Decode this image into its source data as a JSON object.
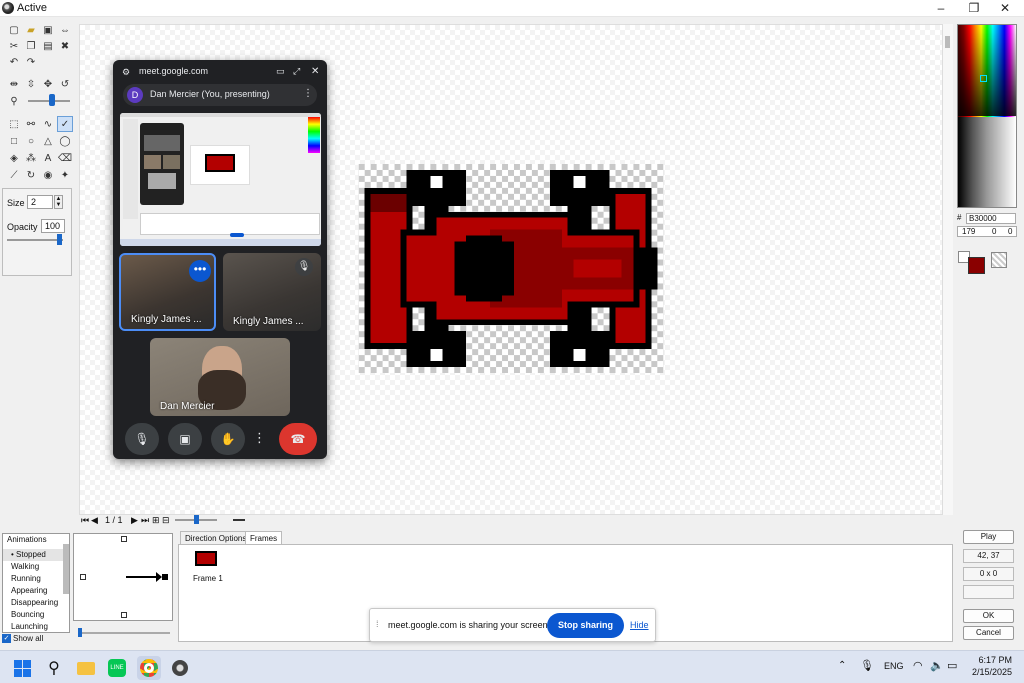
{
  "window": {
    "title": "Active",
    "controls": [
      "–",
      "❐",
      "✕"
    ]
  },
  "tools": {
    "size_label": "Size",
    "size_value": "2",
    "opacity_label": "Opacity",
    "opacity_value": "100"
  },
  "meet": {
    "host": "meet.google.com",
    "presenter_initial": "D",
    "presenter_label": "Dan Mercier (You, presenting)",
    "tiles": [
      {
        "name": "Kingly James ..."
      },
      {
        "name": "Kingly James ..."
      },
      {
        "name": "Dan Mercier"
      }
    ],
    "controls": [
      "mic-icon",
      "camera-icon",
      "hand-icon",
      "more-icon",
      "end-call-icon"
    ]
  },
  "palette": {
    "hex_prefix": "#",
    "hex_value": "B30000",
    "rgb": [
      "179",
      "0",
      "0"
    ],
    "primary_color": "#B30000",
    "secondary_color": "#ffffff"
  },
  "anim_nav": {
    "page": "1 / 1"
  },
  "animations": {
    "header": "Animations",
    "items": [
      "Stopped",
      "Walking",
      "Running",
      "Appearing",
      "Disappearing",
      "Bouncing",
      "Launching"
    ],
    "selected": "Stopped",
    "show_all_label": "Show all"
  },
  "tabs": {
    "direction": "Direction Options",
    "frames": "Frames"
  },
  "frames": {
    "items": [
      {
        "label": "Frame 1"
      }
    ]
  },
  "side_buttons": {
    "play": "Play",
    "coords": "42, 37",
    "size": "0 x 0",
    "ok": "OK",
    "cancel": "Cancel"
  },
  "share_banner": {
    "text": "meet.google.com is sharing your screen.",
    "stop_label": "Stop sharing",
    "hide_label": "Hide"
  },
  "taskbar": {
    "lang": "ENG",
    "time": "6:17 PM",
    "date": "2/15/2025"
  }
}
